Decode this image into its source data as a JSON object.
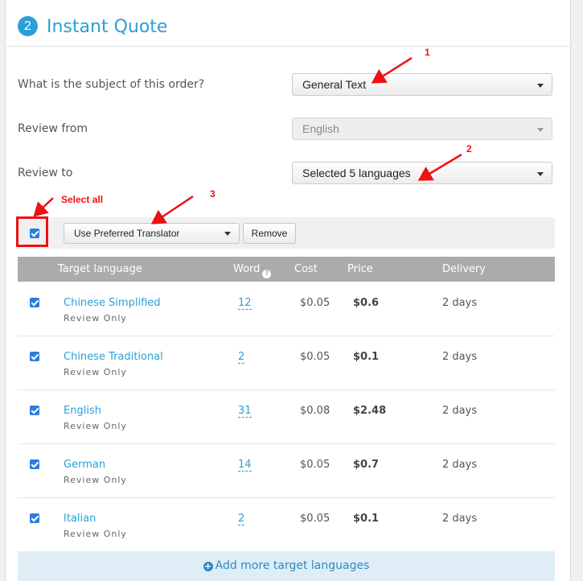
{
  "header": {
    "step_number": "2",
    "title": "Instant Quote"
  },
  "form": {
    "subject": {
      "label": "What is the subject of this order?",
      "value": "General Text"
    },
    "review_from": {
      "label": "Review from",
      "value": "English"
    },
    "review_to": {
      "label": "Review to",
      "value": "Selected 5 languages"
    }
  },
  "bulk": {
    "translator_option": "Use Preferred Translator",
    "remove_label": "Remove"
  },
  "table": {
    "columns": {
      "target": "Target language",
      "word": "Word",
      "cost": "Cost",
      "price": "Price",
      "delivery": "Delivery"
    },
    "rows": [
      {
        "language": "Chinese Simplified",
        "service": "Review Only",
        "words": "12",
        "cost": "$0.05",
        "price": "$0.6",
        "delivery": "2 days"
      },
      {
        "language": "Chinese Traditional",
        "service": "Review Only",
        "words": "2",
        "cost": "$0.05",
        "price": "$0.1",
        "delivery": "2 days"
      },
      {
        "language": "English",
        "service": "Review Only",
        "words": "31",
        "cost": "$0.08",
        "price": "$2.48",
        "delivery": "2 days"
      },
      {
        "language": "German",
        "service": "Review Only",
        "words": "14",
        "cost": "$0.05",
        "price": "$0.7",
        "delivery": "2 days"
      },
      {
        "language": "Italian",
        "service": "Review Only",
        "words": "2",
        "cost": "$0.05",
        "price": "$0.1",
        "delivery": "2 days"
      }
    ]
  },
  "add_more": "Add more target languages",
  "annotations": {
    "one": "1",
    "two": "2",
    "three": "3",
    "select_all": "Select all"
  },
  "colors": {
    "accent": "#2b9fd8",
    "annotation_red": "#e11111",
    "checkbox_blue": "#2b7de0"
  }
}
